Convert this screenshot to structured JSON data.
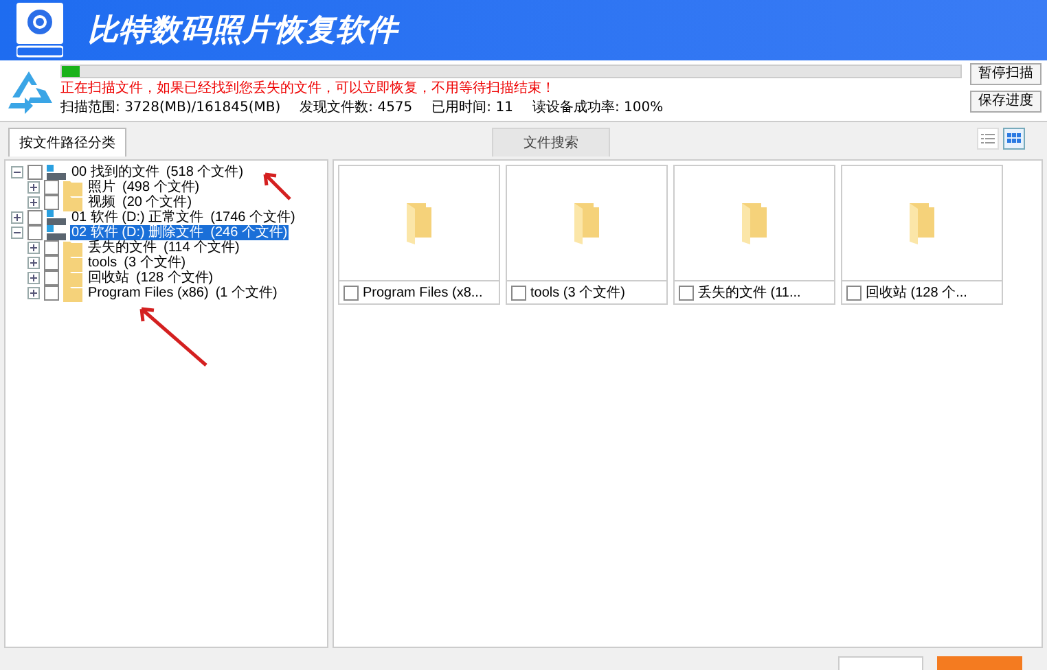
{
  "window": {
    "title": "比特数码照片恢复软件"
  },
  "scan": {
    "level": 0.02,
    "message": "正在扫描文件，如果已经找到您丢失的文件，可以立即恢复，不用等待扫描结束！",
    "stats": [
      {
        "label": "扫描范围:",
        "value": "3728(MB)/161845(MB)"
      },
      {
        "label": "发现文件数:",
        "value": "4575"
      },
      {
        "label": "已用时间:",
        "value": "11"
      },
      {
        "label": "读设备成功率:",
        "value": "100%"
      }
    ],
    "buttons": [
      "暂停扫描",
      "保存进度"
    ]
  },
  "tabs": [
    {
      "label": "按文件路径分类",
      "selected": true
    },
    {
      "label": "文件搜索",
      "selected": false
    }
  ],
  "view_modes": [
    {
      "kind": "list",
      "selected": false
    },
    {
      "kind": "grid",
      "selected": true
    }
  ],
  "tree": [
    {
      "kind": "drive",
      "label": "00 找到的文件",
      "count": "(518 个文件)",
      "expanded": true,
      "checked": false,
      "selected": false,
      "children": [
        {
          "kind": "folder",
          "label": "照片",
          "count": "(498 个文件)",
          "expanded": false,
          "checked": false,
          "selected": false
        },
        {
          "kind": "folder",
          "label": "视频",
          "count": "(20 个文件)",
          "expanded": false,
          "checked": false,
          "selected": false
        }
      ]
    },
    {
      "kind": "drive",
      "label": "01 软件 (D:) 正常文件",
      "count": "(1746 个文件)",
      "expanded": false,
      "checked": false,
      "selected": false
    },
    {
      "kind": "drive",
      "label": "02 软件 (D:) 删除文件",
      "count": "(246 个文件)",
      "expanded": true,
      "checked": false,
      "selected": true,
      "children": [
        {
          "kind": "folder",
          "label": "丢失的文件",
          "count": "(114 个文件)",
          "expanded": false,
          "checked": false,
          "selected": false
        },
        {
          "kind": "folder",
          "label": "tools",
          "count": "(3 个文件)",
          "expanded": false,
          "checked": false,
          "selected": false
        },
        {
          "kind": "folder",
          "label": "回收站",
          "count": "(128 个文件)",
          "expanded": false,
          "checked": false,
          "selected": false
        },
        {
          "kind": "folder",
          "label": "Program Files (x86)",
          "count": "(1 个文件)",
          "expanded": false,
          "checked": false,
          "selected": false
        }
      ]
    }
  ],
  "tiles": [
    {
      "label": "Program Files (x8...",
      "checked": false
    },
    {
      "label": "tools  (3 个文件)",
      "checked": false
    },
    {
      "label": "丢失的文件  (11...",
      "checked": false
    },
    {
      "label": "回收站  (128 个...",
      "checked": false
    }
  ]
}
